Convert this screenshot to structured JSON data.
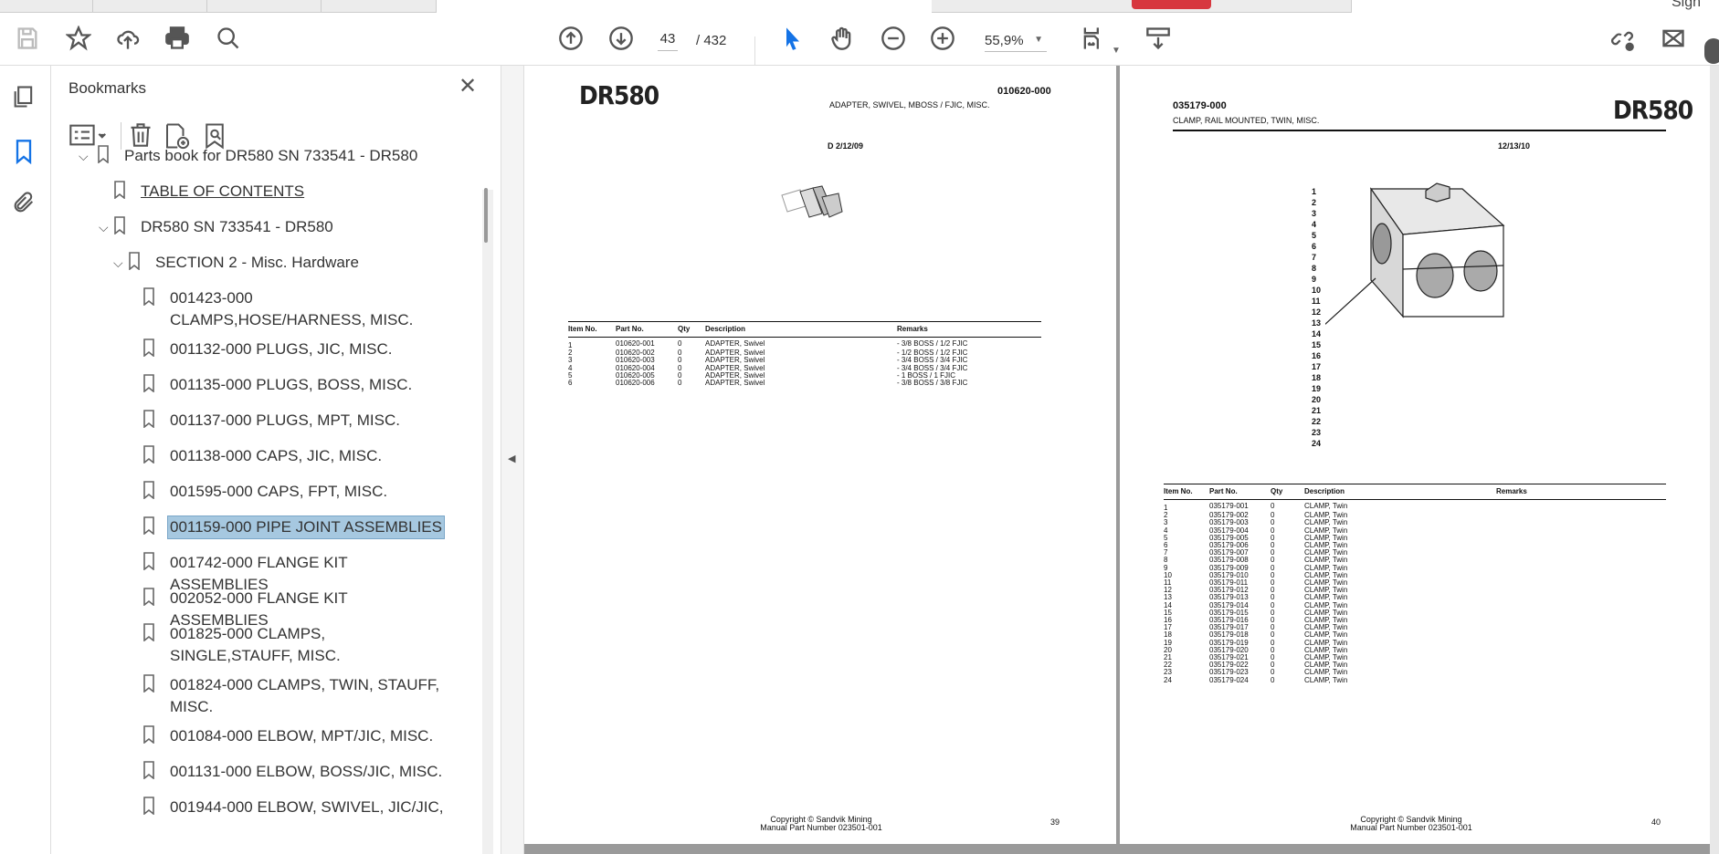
{
  "window": {
    "top_right_label": "Sign"
  },
  "toolbar": {
    "current_page": "43",
    "total_pages": "/ 432",
    "zoom": "55,9%",
    "icons": [
      "save-icon",
      "bookmark-star-icon",
      "upload-cloud-icon",
      "print-icon",
      "search-icon",
      "page-up-icon",
      "page-down-icon",
      "select-cursor-icon",
      "hand-icon",
      "zoom-out-icon",
      "zoom-in-icon",
      "fit-page-icon",
      "scroll-mode-icon",
      "share-link-icon",
      "email-icon"
    ]
  },
  "panel": {
    "title": "Bookmarks",
    "bookmarks": [
      {
        "label": "Parts book for DR580 SN 733541 - DR580",
        "level": 0,
        "expanded": true
      },
      {
        "label": "TABLE OF CONTENTS",
        "level": 1,
        "underline": true
      },
      {
        "label": "DR580 SN 733541 - DR580",
        "level": 1,
        "expanded": true
      },
      {
        "label": "SECTION 2 - Misc. Hardware",
        "level": 2,
        "expanded": true
      },
      {
        "label": "001423-000 CLAMPS,HOSE/HARNESS, MISC.",
        "level": 3
      },
      {
        "label": "001132-000 PLUGS, JIC, MISC.",
        "level": 3
      },
      {
        "label": "001135-000 PLUGS, BOSS, MISC.",
        "level": 3
      },
      {
        "label": "001137-000 PLUGS, MPT, MISC.",
        "level": 3
      },
      {
        "label": "001138-000 CAPS, JIC, MISC.",
        "level": 3
      },
      {
        "label": "001595-000 CAPS, FPT, MISC.",
        "level": 3
      },
      {
        "label": "001159-000 PIPE JOINT ASSEMBLIES",
        "level": 3,
        "selected": true
      },
      {
        "label": "001742-000 FLANGE KIT ASSEMBLIES",
        "level": 3
      },
      {
        "label": "002052-000 FLANGE KIT ASSEMBLIES",
        "level": 3
      },
      {
        "label": "001825-000 CLAMPS, SINGLE,STAUFF, MISC.",
        "level": 3
      },
      {
        "label": "001824-000 CLAMPS, TWIN, STAUFF, MISC.",
        "level": 3
      },
      {
        "label": "001084-000 ELBOW, MPT/JIC, MISC.",
        "level": 3
      },
      {
        "label": "001131-000 ELBOW, BOSS/JIC, MISC.",
        "level": 3
      },
      {
        "label": "001944-000 ELBOW, SWIVEL, JIC/JIC,",
        "level": 3
      }
    ]
  },
  "pages": {
    "left": {
      "logo": "DR580",
      "part_number": "010620-000",
      "title": "ADAPTER, SWIVEL, MBOSS / FJIC, MISC.",
      "revision": "D   2/12/09",
      "headers": [
        "Item No.",
        "Part No.",
        "Qty",
        "Description",
        "Remarks"
      ],
      "rows": [
        [
          "1",
          "010620-001",
          "0",
          "ADAPTER, Swivel",
          "- 3/8 BOSS / 1/2 FJIC"
        ],
        [
          "2",
          "010620-002",
          "0",
          "ADAPTER, Swivel",
          "- 1/2 BOSS / 1/2 FJIC"
        ],
        [
          "3",
          "010620-003",
          "0",
          "ADAPTER, Swivel",
          "- 3/4 BOSS / 3/4 FJIC"
        ],
        [
          "4",
          "010620-004",
          "0",
          "ADAPTER, Swivel",
          "- 3/4 BOSS / 3/4 FJIC"
        ],
        [
          "5",
          "010620-005",
          "0",
          "ADAPTER, Swivel",
          "- 1 BOSS / 1 FJIC"
        ],
        [
          "6",
          "010620-006",
          "0",
          "ADAPTER, Swivel",
          "- 3/8 BOSS / 3/8 FJIC"
        ]
      ],
      "copyright": "Copyright © Sandvik Mining",
      "manual": "Manual Part Number 023501-001",
      "page_number": "39"
    },
    "right": {
      "logo": "DR580",
      "part_number": "035179-000",
      "title": "CLAMP, RAIL MOUNTED, TWIN, MISC.",
      "revision": "12/13/10",
      "callouts": [
        "1",
        "2",
        "3",
        "4",
        "5",
        "6",
        "7",
        "8",
        "9",
        "10",
        "11",
        "12",
        "13",
        "14",
        "15",
        "16",
        "17",
        "18",
        "19",
        "20",
        "21",
        "22",
        "23",
        "24"
      ],
      "headers": [
        "Item No.",
        "Part No.",
        "Qty",
        "Description",
        "Remarks"
      ],
      "rows": [
        [
          "1",
          "035179-001",
          "0",
          "CLAMP, Twin",
          ""
        ],
        [
          "2",
          "035179-002",
          "0",
          "CLAMP, Twin",
          ""
        ],
        [
          "3",
          "035179-003",
          "0",
          "CLAMP, Twin",
          ""
        ],
        [
          "4",
          "035179-004",
          "0",
          "CLAMP, Twin",
          ""
        ],
        [
          "5",
          "035179-005",
          "0",
          "CLAMP, Twin",
          ""
        ],
        [
          "6",
          "035179-006",
          "0",
          "CLAMP, Twin",
          ""
        ],
        [
          "7",
          "035179-007",
          "0",
          "CLAMP, Twin",
          ""
        ],
        [
          "8",
          "035179-008",
          "0",
          "CLAMP, Twin",
          ""
        ],
        [
          "9",
          "035179-009",
          "0",
          "CLAMP, Twin",
          ""
        ],
        [
          "10",
          "035179-010",
          "0",
          "CLAMP, Twin",
          ""
        ],
        [
          "11",
          "035179-011",
          "0",
          "CLAMP, Twin",
          ""
        ],
        [
          "12",
          "035179-012",
          "0",
          "CLAMP, Twin",
          ""
        ],
        [
          "13",
          "035179-013",
          "0",
          "CLAMP, Twin",
          ""
        ],
        [
          "14",
          "035179-014",
          "0",
          "CLAMP, Twin",
          ""
        ],
        [
          "15",
          "035179-015",
          "0",
          "CLAMP, Twin",
          ""
        ],
        [
          "16",
          "035179-016",
          "0",
          "CLAMP, Twin",
          ""
        ],
        [
          "17",
          "035179-017",
          "0",
          "CLAMP, Twin",
          ""
        ],
        [
          "18",
          "035179-018",
          "0",
          "CLAMP, Twin",
          ""
        ],
        [
          "19",
          "035179-019",
          "0",
          "CLAMP, Twin",
          ""
        ],
        [
          "20",
          "035179-020",
          "0",
          "CLAMP, Twin",
          ""
        ],
        [
          "21",
          "035179-021",
          "0",
          "CLAMP, Twin",
          ""
        ],
        [
          "22",
          "035179-022",
          "0",
          "CLAMP, Twin",
          ""
        ],
        [
          "23",
          "035179-023",
          "0",
          "CLAMP, Twin",
          ""
        ],
        [
          "24",
          "035179-024",
          "0",
          "CLAMP, Twin",
          ""
        ]
      ],
      "copyright": "Copyright © Sandvik Mining",
      "manual": "Manual Part Number 023501-001",
      "page_number": "40"
    }
  },
  "colors": {
    "selected_bookmark": "#a6c8e0",
    "accent_blue": "#1473e6",
    "red_button": "#d7373f"
  }
}
